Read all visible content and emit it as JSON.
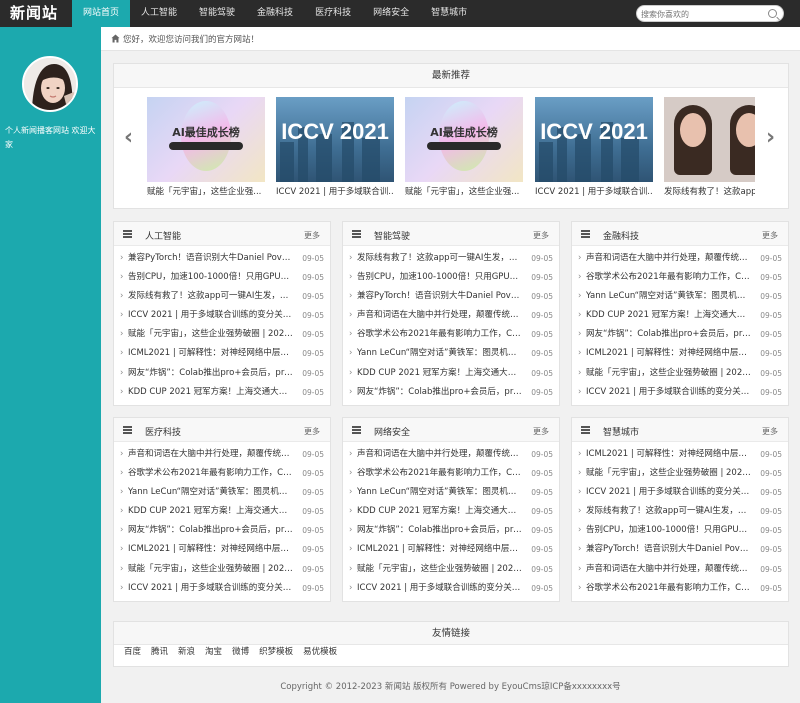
{
  "site": {
    "logo": "新闻站",
    "nav": [
      "网站首页",
      "人工智能",
      "智能驾驶",
      "金融科技",
      "医疗科技",
      "网络安全",
      "智慧城市"
    ],
    "search_placeholder": "搜索你喜欢的"
  },
  "sidebar": {
    "description": "个人新闻播客网站 欢迎大家"
  },
  "welcome": "您好，欢迎您访问我们的官方网站！",
  "featured": {
    "title": "最新推荐",
    "slides": [
      {
        "image": "ai-banner",
        "img_text": "AI最佳成长榜",
        "caption": "赋能「元宇宙」，这些企业强..."
      },
      {
        "image": "iccv-banner",
        "img_text": "ICCV 2021",
        "caption": "ICCV 2021 | 用于多域联合训..."
      },
      {
        "image": "ai-banner",
        "img_text": "AI最佳成长榜",
        "caption": "赋能「元宇宙」，这些企业强..."
      },
      {
        "image": "iccv-banner",
        "img_text": "ICCV 2021",
        "caption": "ICCV 2021 | 用于多域联合训..."
      },
      {
        "image": "faces-photo",
        "img_text": "",
        "caption": "发际线有救了！这款app..."
      }
    ]
  },
  "more_label": "更多",
  "categories": [
    {
      "title": "人工智能",
      "items": [
        {
          "t": "兼容PyTorch！语音识别大牛Daniel Povey正...",
          "d": "09-05"
        },
        {
          "t": "告别CPU，加速100-1000倍！只用GPU就能...",
          "d": "09-05"
        },
        {
          "t": "发际线有救了！这款app可一键AI生发，拯救...",
          "d": "09-05"
        },
        {
          "t": "ICCV 2021 | 用于多域联合训练的变分关注模型",
          "d": "09-05"
        },
        {
          "t": "赋能「元宇宙」，这些企业强势破圈 | 2021AI...",
          "d": "09-05"
        },
        {
          "t": "ICML2021 | 可解释性：对神经网络中层特征...",
          "d": "09-05"
        },
        {
          "t": "网友“炸锅”：Colab推出pro+会员后，pro...",
          "d": "09-05"
        },
        {
          "t": "KDD CUP 2021 冠军方案！上海交通大学电子...",
          "d": "09-05"
        }
      ]
    },
    {
      "title": "智能驾驶",
      "items": [
        {
          "t": "发际线有救了！这款app可一键AI生发，拯救...",
          "d": "09-05"
        },
        {
          "t": "告别CPU，加速100-1000倍！只用GPU就能...",
          "d": "09-05"
        },
        {
          "t": "兼容PyTorch！语音识别大牛Daniel Povey正...",
          "d": "09-05"
        },
        {
          "t": "声音和词语在大脑中并行处理，颠覆传统研究 ...",
          "d": "09-05"
        },
        {
          "t": "谷歌学术公布2021年最有影响力工作，CV顶...",
          "d": "09-05"
        },
        {
          "t": "Yann LeCun“隔空对话”黄铁军：图灵机上...",
          "d": "09-05"
        },
        {
          "t": "KDD CUP 2021 冠军方案！上海交通大学电子...",
          "d": "09-05"
        },
        {
          "t": "网友“炸锅”：Colab推出pro+会员后，pro...",
          "d": "09-05"
        }
      ]
    },
    {
      "title": "金融科技",
      "items": [
        {
          "t": "声音和词语在大脑中并行处理，颠覆传统研究 ...",
          "d": "09-05"
        },
        {
          "t": "谷歌学术公布2021年最有影响力工作，CV顶...",
          "d": "09-05"
        },
        {
          "t": "Yann LeCun“隔空对话”黄铁军：图灵机上...",
          "d": "09-05"
        },
        {
          "t": "KDD CUP 2021 冠军方案！上海交通大学电子...",
          "d": "09-05"
        },
        {
          "t": "网友“炸锅”：Colab推出pro+会员后，pro...",
          "d": "09-05"
        },
        {
          "t": "ICML2021 | 可解释性：对神经网络中层特征...",
          "d": "09-05"
        },
        {
          "t": "赋能「元宇宙」，这些企业强势破圈 | 2021AI...",
          "d": "09-05"
        },
        {
          "t": "ICCV 2021 | 用于多域联合训练的变分关注模型",
          "d": "09-05"
        }
      ]
    },
    {
      "title": "医疗科技",
      "items": [
        {
          "t": "声音和词语在大脑中并行处理，颠覆传统研究 ...",
          "d": "09-05"
        },
        {
          "t": "谷歌学术公布2021年最有影响力工作，CV顶...",
          "d": "09-05"
        },
        {
          "t": "Yann LeCun“隔空对话”黄铁军：图灵机上...",
          "d": "09-05"
        },
        {
          "t": "KDD CUP 2021 冠军方案！上海交通大学电子...",
          "d": "09-05"
        },
        {
          "t": "网友“炸锅”：Colab推出pro+会员后，pro...",
          "d": "09-05"
        },
        {
          "t": "ICML2021 | 可解释性：对神经网络中层特征...",
          "d": "09-05"
        },
        {
          "t": "赋能「元宇宙」，这些企业强势破圈 | 2021AI...",
          "d": "09-05"
        },
        {
          "t": "ICCV 2021 | 用于多域联合训练的变分关注模型",
          "d": "09-05"
        }
      ]
    },
    {
      "title": "网络安全",
      "items": [
        {
          "t": "声音和词语在大脑中并行处理，颠覆传统研究 ...",
          "d": "09-05"
        },
        {
          "t": "谷歌学术公布2021年最有影响力工作，CV顶...",
          "d": "09-05"
        },
        {
          "t": "Yann LeCun“隔空对话”黄铁军：图灵机上...",
          "d": "09-05"
        },
        {
          "t": "KDD CUP 2021 冠军方案！上海交通大学电子...",
          "d": "09-05"
        },
        {
          "t": "网友“炸锅”：Colab推出pro+会员后，pro...",
          "d": "09-05"
        },
        {
          "t": "ICML2021 | 可解释性：对神经网络中层特征...",
          "d": "09-05"
        },
        {
          "t": "赋能「元宇宙」，这些企业强势破圈 | 2021AI...",
          "d": "09-05"
        },
        {
          "t": "ICCV 2021 | 用于多域联合训练的变分关注模型",
          "d": "09-05"
        }
      ]
    },
    {
      "title": "智慧城市",
      "items": [
        {
          "t": "ICML2021 | 可解释性：对神经网络中层特征...",
          "d": "09-05"
        },
        {
          "t": "赋能「元宇宙」，这些企业强势破圈 | 2021AI...",
          "d": "09-05"
        },
        {
          "t": "ICCV 2021 | 用于多域联合训练的变分关注模型",
          "d": "09-05"
        },
        {
          "t": "发际线有救了！这款app可一键AI生发，拯救...",
          "d": "09-05"
        },
        {
          "t": "告别CPU，加速100-1000倍！只用GPU就能...",
          "d": "09-05"
        },
        {
          "t": "兼容PyTorch！语音识别大牛Daniel Povey正...",
          "d": "09-05"
        },
        {
          "t": "声音和词语在大脑中并行处理，颠覆传统研究 ...",
          "d": "09-05"
        },
        {
          "t": "谷歌学术公布2021年最有影响力工作，CV顶...",
          "d": "09-05"
        }
      ]
    }
  ],
  "friend_links": {
    "title": "友情链接",
    "items": [
      "百度",
      "腾讯",
      "新浪",
      "淘宝",
      "微博",
      "织梦模板",
      "易优模板"
    ]
  },
  "footer": "Copyright © 2012-2023 新闻站 版权所有 Powered by EyouCms琼ICP备xxxxxxxx号",
  "colors": {
    "accent": "#1ca9ae",
    "topbar": "#2b2b2b"
  }
}
